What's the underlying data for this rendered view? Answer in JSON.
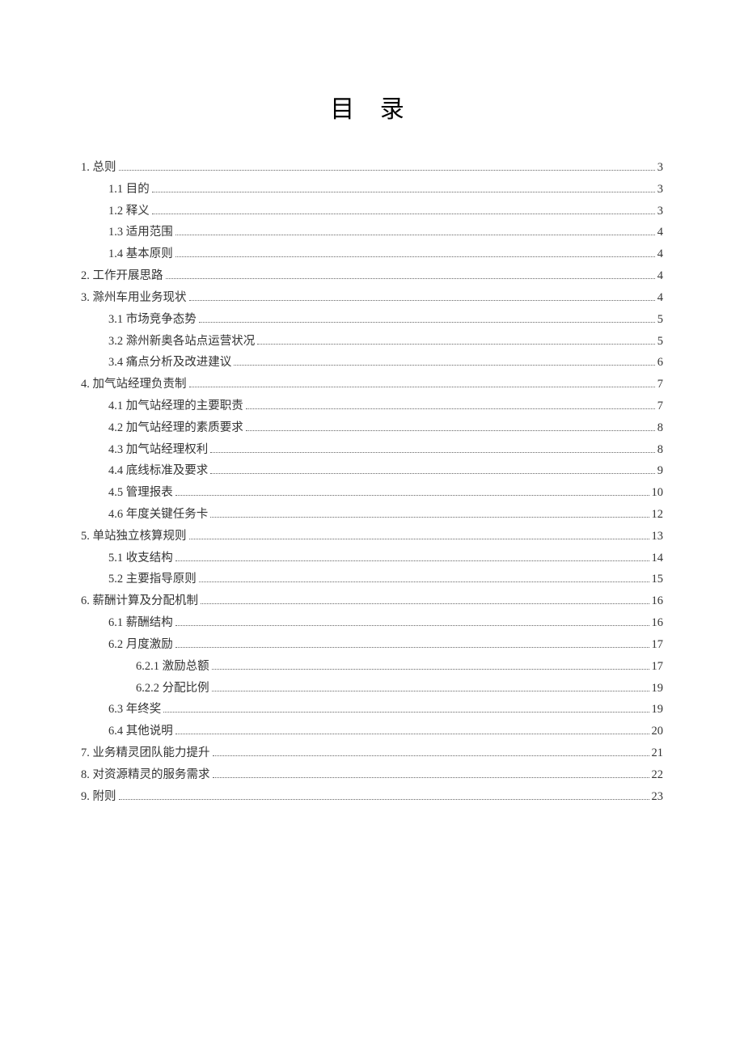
{
  "title": "目 录",
  "toc": [
    {
      "level": 1,
      "num": "1.",
      "text": "总则",
      "page": "3",
      "gap": true
    },
    {
      "level": 2,
      "num": "1.1",
      "text": "目的",
      "page": "3"
    },
    {
      "level": 2,
      "num": "1.2",
      "text": "释义",
      "page": "3"
    },
    {
      "level": 2,
      "num": "1.3",
      "text": "适用范围",
      "page": "4"
    },
    {
      "level": 2,
      "num": "1.4",
      "text": "基本原则",
      "page": "4"
    },
    {
      "level": 1,
      "num": "2.",
      "text": "工作开展思路",
      "page": "4",
      "gap": true
    },
    {
      "level": 1,
      "num": "3.",
      "text": "滁州车用业务现状",
      "page": "4",
      "gap": true
    },
    {
      "level": 2,
      "num": "3.1",
      "text": "市场竞争态势",
      "page": "5"
    },
    {
      "level": 2,
      "num": "3.2",
      "text": "滁州新奥各站点运营状况",
      "page": "5"
    },
    {
      "level": 2,
      "num": "3.4",
      "text": "痛点分析及改进建议",
      "page": "6"
    },
    {
      "level": 1,
      "num": "4.",
      "text": "加气站经理负责制",
      "page": "7",
      "gap": true
    },
    {
      "level": 2,
      "num": "4.1",
      "text": "加气站经理的主要职责",
      "page": "7"
    },
    {
      "level": 2,
      "num": "4.2",
      "text": "加气站经理的素质要求",
      "page": "8"
    },
    {
      "level": 2,
      "num": "4.3",
      "text": "加气站经理权利",
      "page": "8"
    },
    {
      "level": 2,
      "num": "4.4",
      "text": "底线标准及要求",
      "page": "9"
    },
    {
      "level": 2,
      "num": "4.5",
      "text": "管理报表",
      "page": "10"
    },
    {
      "level": 2,
      "num": "4.6",
      "text": "年度关键任务卡",
      "page": "12"
    },
    {
      "level": 1,
      "num": "5.",
      "text": "单站独立核算规则",
      "page": "13",
      "gap": false
    },
    {
      "level": 2,
      "num": "5.1",
      "text": "收支结构",
      "page": "14"
    },
    {
      "level": 2,
      "num": "5.2",
      "text": "主要指导原则",
      "page": "15"
    },
    {
      "level": 1,
      "num": "6.",
      "text": "薪酬计算及分配机制",
      "page": "16",
      "gap": false
    },
    {
      "level": 2,
      "num": "6.1",
      "text": "薪酬结构",
      "page": "16"
    },
    {
      "level": 2,
      "num": "6.2",
      "text": "月度激励",
      "page": "17"
    },
    {
      "level": 3,
      "num": "6.2.1",
      "text": "激励总额",
      "page": "17"
    },
    {
      "level": 3,
      "num": "6.2.2",
      "text": "分配比例",
      "page": "19"
    },
    {
      "level": 2,
      "num": "6.3",
      "text": "年终奖",
      "page": "19"
    },
    {
      "level": 2,
      "num": "6.4",
      "text": "其他说明",
      "page": "20"
    },
    {
      "level": 1,
      "num": "7.",
      "text": "业务精灵团队能力提升",
      "page": "21",
      "gap": false
    },
    {
      "level": 1,
      "num": "8.",
      "text": "对资源精灵的服务需求",
      "page": "22",
      "gap": false
    },
    {
      "level": 1,
      "num": "9.",
      "text": "附则",
      "page": "23",
      "gap": false
    }
  ]
}
